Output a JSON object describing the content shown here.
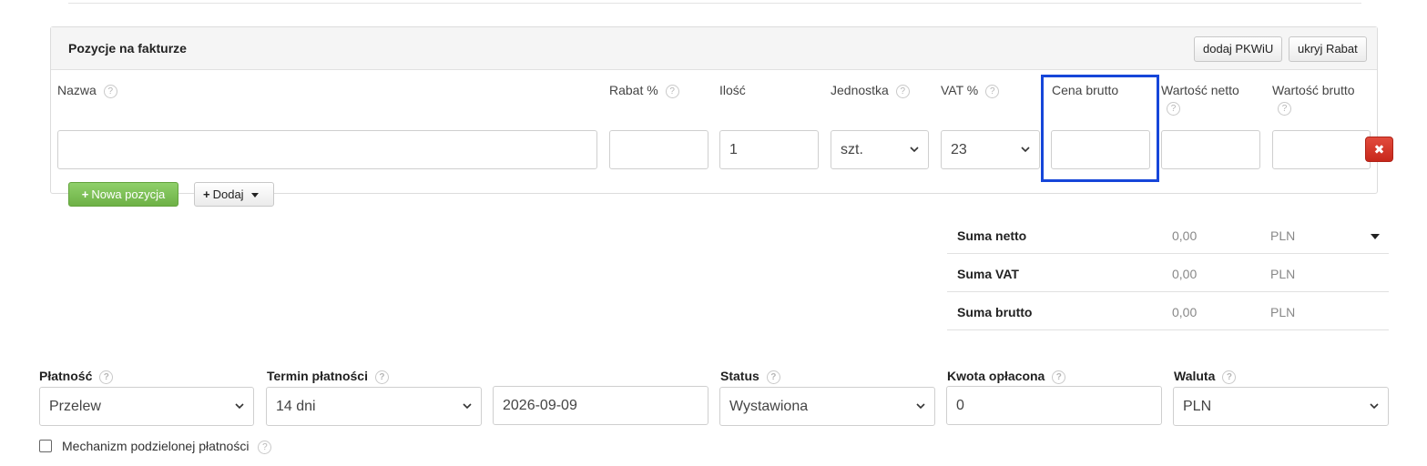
{
  "panel": {
    "title": "Pozycje na fakturze",
    "add_pkwiu_label": "dodaj PKWiU",
    "hide_discount_label": "ukryj Rabat"
  },
  "columns": {
    "name": "Nazwa",
    "discount": "Rabat %",
    "quantity": "Ilość",
    "unit": "Jednostka",
    "vat": "VAT %",
    "gross_price": "Cena brutto",
    "net_value": "Wartość netto",
    "gross_value": "Wartość brutto"
  },
  "row": {
    "name_value": "",
    "discount_value": "",
    "quantity_value": "1",
    "unit_selected": "szt.",
    "vat_selected": "23",
    "gross_price_value": "",
    "net_value_value": "",
    "gross_value_value": ""
  },
  "actions": {
    "new_item_label": "Nowa pozycja",
    "add_label": "Dodaj"
  },
  "summary": [
    {
      "label": "Suma netto",
      "value": "0,00",
      "currency": "PLN"
    },
    {
      "label": "Suma VAT",
      "value": "0,00",
      "currency": "PLN"
    },
    {
      "label": "Suma brutto",
      "value": "0,00",
      "currency": "PLN"
    }
  ],
  "payment": {
    "method_label": "Płatność",
    "method_value": "Przelew",
    "term_label": "Termin płatności",
    "term_value": "14 dni",
    "due_date": "2026-09-09",
    "status_label": "Status",
    "status_value": "Wystawiona",
    "paid_label": "Kwota opłacona",
    "paid_value": "0",
    "currency_label": "Waluta",
    "currency_value": "PLN"
  },
  "split_payment": {
    "label": "Mechanizm podzielonej płatności",
    "checked": false
  },
  "icons": {
    "help": "?",
    "delete": "✖",
    "plus": "+"
  },
  "colors": {
    "highlight": "#1646d9",
    "green_button": "#6eb146",
    "delete_button": "#c7281b"
  }
}
